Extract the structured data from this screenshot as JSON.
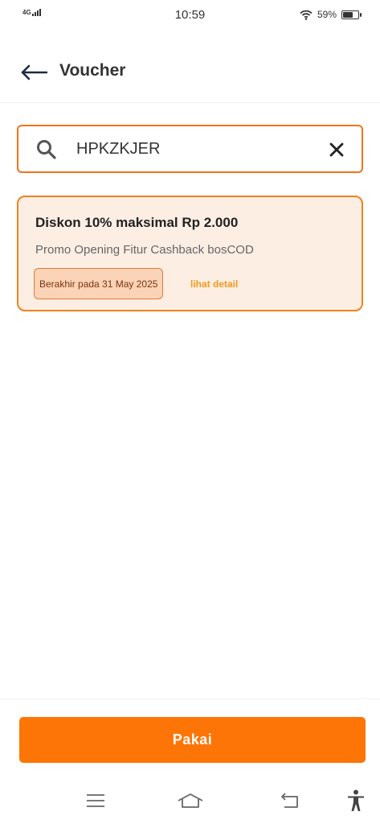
{
  "status_bar": {
    "network": "4G",
    "time": "10:59",
    "battery_percent": "59%",
    "battery_level": 0.59,
    "icons": [
      "signal-icon",
      "wifi-icon",
      "battery-icon"
    ]
  },
  "header": {
    "title": "Voucher",
    "back_icon": "arrow-left-icon"
  },
  "search": {
    "value": "HPKZKJER",
    "placeholder": "",
    "search_icon": "search-icon",
    "clear_icon": "close-icon"
  },
  "voucher": {
    "title": "Diskon 10% maksimal Rp 2.000",
    "subtitle": "Promo Opening Fitur Cashback bosCOD",
    "expiry": "Berakhir pada 31 May 2025",
    "detail_link": "lihat detail"
  },
  "actions": {
    "submit_label": "Pakai"
  },
  "navigation": {
    "icons": [
      "menu-icon",
      "home-icon",
      "back-icon",
      "accessibility-icon"
    ]
  },
  "colors": {
    "accent": "#fd7506",
    "card_background": "#fdeee4",
    "card_border": "#f0831e",
    "badge_background": "#fbd3b6",
    "link": "#f59a1b"
  }
}
